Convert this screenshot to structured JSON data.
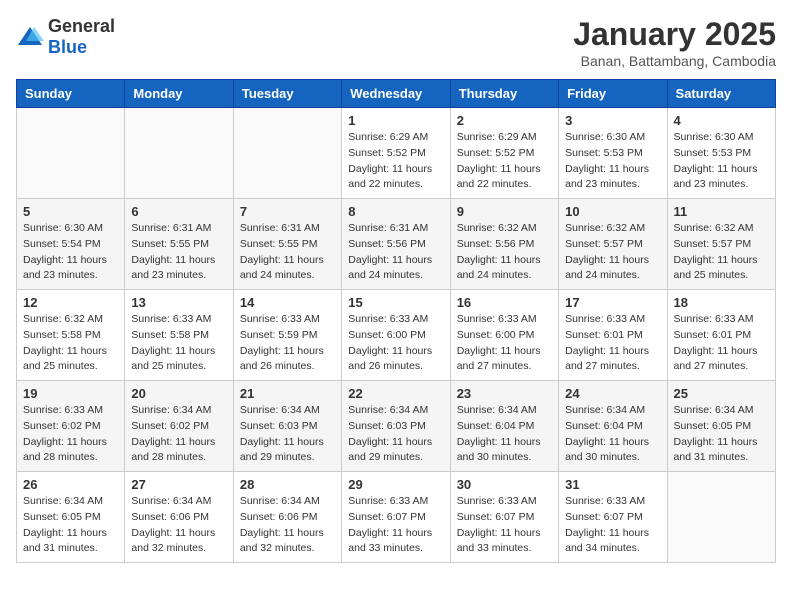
{
  "header": {
    "logo_general": "General",
    "logo_blue": "Blue",
    "month_title": "January 2025",
    "subtitle": "Banan, Battambang, Cambodia"
  },
  "weekdays": [
    "Sunday",
    "Monday",
    "Tuesday",
    "Wednesday",
    "Thursday",
    "Friday",
    "Saturday"
  ],
  "weeks": [
    [
      null,
      null,
      null,
      {
        "day": 1,
        "sunrise": "6:29 AM",
        "sunset": "5:52 PM",
        "daylight": "11 hours and 22 minutes."
      },
      {
        "day": 2,
        "sunrise": "6:29 AM",
        "sunset": "5:52 PM",
        "daylight": "11 hours and 22 minutes."
      },
      {
        "day": 3,
        "sunrise": "6:30 AM",
        "sunset": "5:53 PM",
        "daylight": "11 hours and 23 minutes."
      },
      {
        "day": 4,
        "sunrise": "6:30 AM",
        "sunset": "5:53 PM",
        "daylight": "11 hours and 23 minutes."
      }
    ],
    [
      {
        "day": 5,
        "sunrise": "6:30 AM",
        "sunset": "5:54 PM",
        "daylight": "11 hours and 23 minutes."
      },
      {
        "day": 6,
        "sunrise": "6:31 AM",
        "sunset": "5:55 PM",
        "daylight": "11 hours and 23 minutes."
      },
      {
        "day": 7,
        "sunrise": "6:31 AM",
        "sunset": "5:55 PM",
        "daylight": "11 hours and 24 minutes."
      },
      {
        "day": 8,
        "sunrise": "6:31 AM",
        "sunset": "5:56 PM",
        "daylight": "11 hours and 24 minutes."
      },
      {
        "day": 9,
        "sunrise": "6:32 AM",
        "sunset": "5:56 PM",
        "daylight": "11 hours and 24 minutes."
      },
      {
        "day": 10,
        "sunrise": "6:32 AM",
        "sunset": "5:57 PM",
        "daylight": "11 hours and 24 minutes."
      },
      {
        "day": 11,
        "sunrise": "6:32 AM",
        "sunset": "5:57 PM",
        "daylight": "11 hours and 25 minutes."
      }
    ],
    [
      {
        "day": 12,
        "sunrise": "6:32 AM",
        "sunset": "5:58 PM",
        "daylight": "11 hours and 25 minutes."
      },
      {
        "day": 13,
        "sunrise": "6:33 AM",
        "sunset": "5:58 PM",
        "daylight": "11 hours and 25 minutes."
      },
      {
        "day": 14,
        "sunrise": "6:33 AM",
        "sunset": "5:59 PM",
        "daylight": "11 hours and 26 minutes."
      },
      {
        "day": 15,
        "sunrise": "6:33 AM",
        "sunset": "6:00 PM",
        "daylight": "11 hours and 26 minutes."
      },
      {
        "day": 16,
        "sunrise": "6:33 AM",
        "sunset": "6:00 PM",
        "daylight": "11 hours and 27 minutes."
      },
      {
        "day": 17,
        "sunrise": "6:33 AM",
        "sunset": "6:01 PM",
        "daylight": "11 hours and 27 minutes."
      },
      {
        "day": 18,
        "sunrise": "6:33 AM",
        "sunset": "6:01 PM",
        "daylight": "11 hours and 27 minutes."
      }
    ],
    [
      {
        "day": 19,
        "sunrise": "6:33 AM",
        "sunset": "6:02 PM",
        "daylight": "11 hours and 28 minutes."
      },
      {
        "day": 20,
        "sunrise": "6:34 AM",
        "sunset": "6:02 PM",
        "daylight": "11 hours and 28 minutes."
      },
      {
        "day": 21,
        "sunrise": "6:34 AM",
        "sunset": "6:03 PM",
        "daylight": "11 hours and 29 minutes."
      },
      {
        "day": 22,
        "sunrise": "6:34 AM",
        "sunset": "6:03 PM",
        "daylight": "11 hours and 29 minutes."
      },
      {
        "day": 23,
        "sunrise": "6:34 AM",
        "sunset": "6:04 PM",
        "daylight": "11 hours and 30 minutes."
      },
      {
        "day": 24,
        "sunrise": "6:34 AM",
        "sunset": "6:04 PM",
        "daylight": "11 hours and 30 minutes."
      },
      {
        "day": 25,
        "sunrise": "6:34 AM",
        "sunset": "6:05 PM",
        "daylight": "11 hours and 31 minutes."
      }
    ],
    [
      {
        "day": 26,
        "sunrise": "6:34 AM",
        "sunset": "6:05 PM",
        "daylight": "11 hours and 31 minutes."
      },
      {
        "day": 27,
        "sunrise": "6:34 AM",
        "sunset": "6:06 PM",
        "daylight": "11 hours and 32 minutes."
      },
      {
        "day": 28,
        "sunrise": "6:34 AM",
        "sunset": "6:06 PM",
        "daylight": "11 hours and 32 minutes."
      },
      {
        "day": 29,
        "sunrise": "6:33 AM",
        "sunset": "6:07 PM",
        "daylight": "11 hours and 33 minutes."
      },
      {
        "day": 30,
        "sunrise": "6:33 AM",
        "sunset": "6:07 PM",
        "daylight": "11 hours and 33 minutes."
      },
      {
        "day": 31,
        "sunrise": "6:33 AM",
        "sunset": "6:07 PM",
        "daylight": "11 hours and 34 minutes."
      },
      null
    ]
  ]
}
